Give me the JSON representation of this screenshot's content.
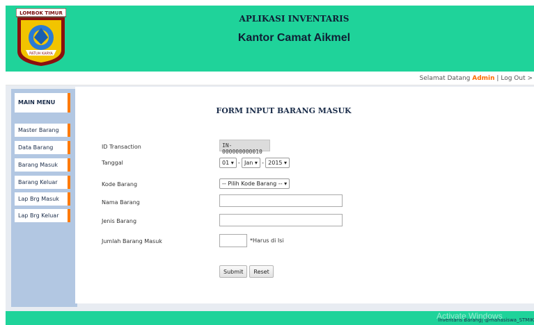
{
  "colors": {
    "header_bg": "#1fd39a",
    "accent": "#ff7a00",
    "sidebar_bg": "#b2c7e2"
  },
  "logo": {
    "badge_text": "LOMBOK TIMUR",
    "ribbon_text": "PATUH KARYA"
  },
  "header": {
    "app_title": "APLIKASI INVENTARIS",
    "subtitle": "Kantor Camat Aikmel"
  },
  "userbar": {
    "greeting": "Selamat Datang",
    "user": "Admin",
    "separator": "|",
    "logout": "Log Out >"
  },
  "sidebar": {
    "heading": "MAIN MENU",
    "items": [
      {
        "label": "Master Barang"
      },
      {
        "label": "Data Barang"
      },
      {
        "label": "Barang Masuk"
      },
      {
        "label": "Barang Keluar"
      },
      {
        "label": "Lap Brg Masuk"
      },
      {
        "label": "Lap Brg Keluar"
      }
    ]
  },
  "form": {
    "title": "FORM INPUT BARANG MASUK",
    "id_label": "ID Transaction",
    "id_value": "IN-000000000010",
    "tanggal_label": "Tanggal",
    "day": "01",
    "month": "Jan",
    "year": "2015",
    "date_sep": "-",
    "kode_label": "Kode Barang",
    "kode_selected": "-- Pilih Kode Barang --",
    "nama_label": "Nama Barang",
    "nama_value": "",
    "jenis_label": "Jenis Barang",
    "jenis_value": "",
    "jumlah_label": "Jumlah Barang Masuk",
    "jumlah_value": "",
    "required_note": "*Harus di Isi",
    "submit_label": "Submit",
    "reset_label": "Reset"
  },
  "footer": {
    "watermark": "Activate Windows",
    "text": "Inventaris Barang| @mahasiswa_STMIK"
  }
}
